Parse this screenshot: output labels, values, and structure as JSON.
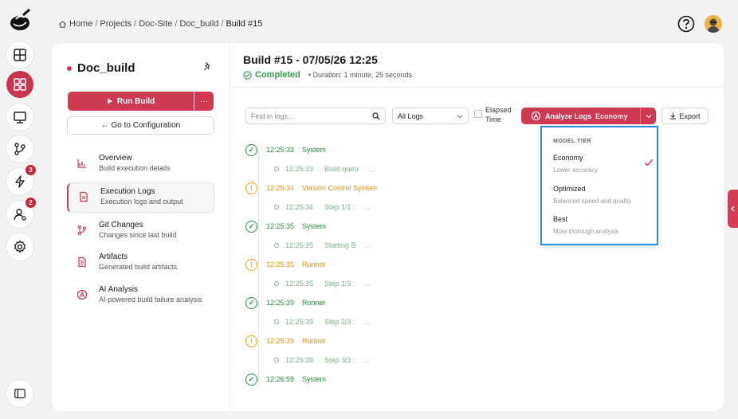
{
  "breadcrumb": [
    "Home",
    "Projects",
    "Doc-Site",
    "Doc_build",
    "Build #15"
  ],
  "sidebar": {
    "project_name": "Doc_build",
    "run_label": "Run Build",
    "more_label": "···",
    "config_label": "← Go to Configuration",
    "nav": [
      {
        "title": "Overview",
        "subtitle": "Build execution details",
        "icon": "chart-icon"
      },
      {
        "title": "Execution Logs",
        "subtitle": "Execution logs and output",
        "icon": "file-icon"
      },
      {
        "title": "Git Changes",
        "subtitle": "Changes since last build",
        "icon": "git-branch-icon"
      },
      {
        "title": "Artifacts",
        "subtitle": "Generated build artifacts",
        "icon": "document-icon"
      },
      {
        "title": "AI Analysis",
        "subtitle": "AI-powered build failure analysis",
        "icon": "ai-icon"
      }
    ]
  },
  "rail": {
    "badges": {
      "deployments": "3",
      "users": "2"
    }
  },
  "build": {
    "title": "Build #15 - 07/05/26 12:25",
    "status": "Completed",
    "duration": "• Duration: 1 minute, 25 seconds"
  },
  "toolbar": {
    "search_placeholder": "Find in logs...",
    "filter_value": "All Logs",
    "elapsed_label_1": "Elapsed",
    "elapsed_label_2": "Time",
    "analyze_label": "Analyze Logs",
    "analyze_tier": "Economy",
    "export_label": "Export"
  },
  "logs": [
    {
      "type": "event",
      "status": "success",
      "time": "12:25:33",
      "source": "System"
    },
    {
      "type": "step",
      "time": "12:25:33",
      "text": "Build queu"
    },
    {
      "type": "event",
      "status": "warning",
      "time": "12:25:34",
      "source": "Version Control System"
    },
    {
      "type": "step",
      "time": "12:25:34",
      "text": "Step 1/1 :"
    },
    {
      "type": "event",
      "status": "success",
      "time": "12:25:35",
      "source": "System"
    },
    {
      "type": "step",
      "time": "12:25:35",
      "text": "Starting B"
    },
    {
      "type": "event",
      "status": "warning",
      "time": "12:25:35",
      "source": "Runner"
    },
    {
      "type": "step",
      "time": "12:25:35",
      "text": "Step 1/3 :"
    },
    {
      "type": "event",
      "status": "success",
      "time": "12:25:39",
      "source": "Runner"
    },
    {
      "type": "step",
      "time": "12:25:39",
      "text": "Step 2/3 :"
    },
    {
      "type": "event",
      "status": "warning",
      "time": "12:25:39",
      "source": "Runner"
    },
    {
      "type": "step",
      "time": "12:25:39",
      "text": "Step 3/3 :"
    },
    {
      "type": "event",
      "status": "success",
      "time": "12:26:59",
      "source": "System"
    }
  ],
  "model_tier": {
    "header": "MODEL TIER",
    "options": [
      {
        "name": "Economy",
        "desc": "Lower accuracy",
        "selected": true
      },
      {
        "name": "Optimized",
        "desc": "Balanced speed and quality",
        "selected": false
      },
      {
        "name": "Best",
        "desc": "Most thorough analysis",
        "selected": false
      }
    ]
  },
  "colors": {
    "accent": "#cf3a52",
    "success": "#2e8b3e",
    "warning": "#e8a41a",
    "highlight": "#2a8ce0"
  }
}
